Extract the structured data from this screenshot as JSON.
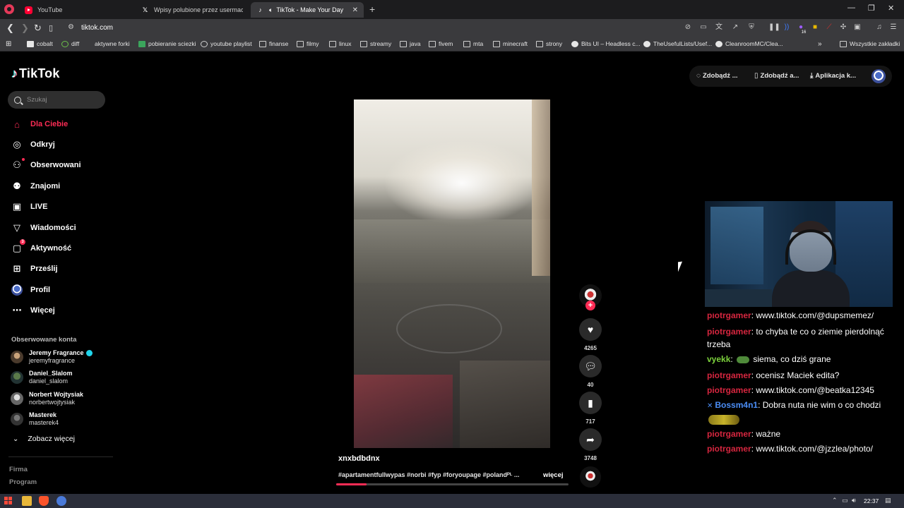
{
  "browser": {
    "tabs": [
      {
        "label": "YouTube",
        "icon": "youtube-icon"
      },
      {
        "label": "Wpisy polubione przez usermaciej (@",
        "icon": "x-icon"
      },
      {
        "label": "TikTok - Make Your Day",
        "icon": "tiktok-icon",
        "active": true
      }
    ],
    "url": "tiktok.com",
    "bookmarks": [
      "cobalt",
      "diff",
      "aktywne forki",
      "pobieranie sciezki",
      "youtube playlist",
      "finanse",
      "filmy",
      "linux",
      "streamy",
      "java",
      "fivem",
      "mta",
      "minecraft",
      "strony",
      "Bits UI – Headless c...",
      "TheUsefulLists/Usef...",
      "CleanroomMC/Clea..."
    ],
    "all_bookmarks": "Wszystkie zakładki",
    "extension_badge": "16"
  },
  "tiktok": {
    "logo_text": "TikTok",
    "search_placeholder": "Szukaj",
    "nav": [
      {
        "label": "Dla Ciebie",
        "icon": "home-icon",
        "active": true
      },
      {
        "label": "Odkryj",
        "icon": "compass-icon"
      },
      {
        "label": "Obserwowani",
        "icon": "following-icon"
      },
      {
        "label": "Znajomi",
        "icon": "friends-icon"
      },
      {
        "label": "LIVE",
        "icon": "live-icon"
      },
      {
        "label": "Wiadomości",
        "icon": "messages-icon"
      },
      {
        "label": "Aktywność",
        "icon": "activity-icon",
        "badge": "3"
      },
      {
        "label": "Prześlij",
        "icon": "upload-icon"
      },
      {
        "label": "Profil",
        "icon": "profile-avatar"
      },
      {
        "label": "Więcej",
        "icon": "more-icon"
      }
    ],
    "followed_title": "Obserwowane konta",
    "followed": [
      {
        "name": "Jeremy Fragrance",
        "handle": "jeremyfragrance",
        "verified": true
      },
      {
        "name": "Daniel_Slalom",
        "handle": "daniel_slalom"
      },
      {
        "name": "Norbert Wojtysiak",
        "handle": "norbertwojtysiak"
      },
      {
        "name": "Masterek",
        "handle": "masterek4"
      }
    ],
    "see_more": "Zobacz więcej",
    "footer": [
      "Firma",
      "Program"
    ],
    "top_buttons": [
      "Zdobądź ...",
      "Zdobądź a...",
      "Aplikacja k..."
    ],
    "video": {
      "author": "xnxbdbdnx",
      "description": "#apartamentfullwypas #norbi #fyp #foryoupage #polandᴾᴸ ...",
      "more": "więcej",
      "progress": 0.13
    },
    "actions": {
      "likes": "4265",
      "comments": "40",
      "saves": "717",
      "shares": "3748"
    }
  },
  "stream_chat": [
    {
      "user": "piotrgamer",
      "sep": ": ",
      "text": "www.tiktok.com/@dupsmemez/",
      "color": "piotr"
    },
    {
      "user": "piotrgamer",
      "sep": ": ",
      "text": "to chyba te co o ziemie pierdolnąć trzeba",
      "color": "piotr"
    },
    {
      "user": "vyekk",
      "sep": ": ",
      "text": "siema, co dziś grane",
      "color": "vyekk"
    },
    {
      "user": "piotrgamer",
      "sep": ": ",
      "text": "ocenisz Maciek edita?",
      "color": "piotr"
    },
    {
      "user": "piotrgamer",
      "sep": ": ",
      "text": "www.tiktok.com/@beatka12345",
      "color": "piotr"
    },
    {
      "user": "Bossm4n1",
      "sep": ": ",
      "text": "Dobra nuta nie wim o co chodzi",
      "color": "boss"
    },
    {
      "user": "piotrgamer",
      "sep": ": ",
      "text": "ważne",
      "color": "piotr"
    },
    {
      "user": "piotrgamer",
      "sep": ": ",
      "text": "www.tiktok.com/@jzzlea/photo/",
      "color": "piotr"
    }
  ],
  "taskbar": {
    "time": "22:37"
  },
  "colors": {
    "accent": "#fe2c55",
    "piotr": "#d6263f",
    "vyekk": "#7cd13c",
    "boss": "#4b8df5"
  }
}
